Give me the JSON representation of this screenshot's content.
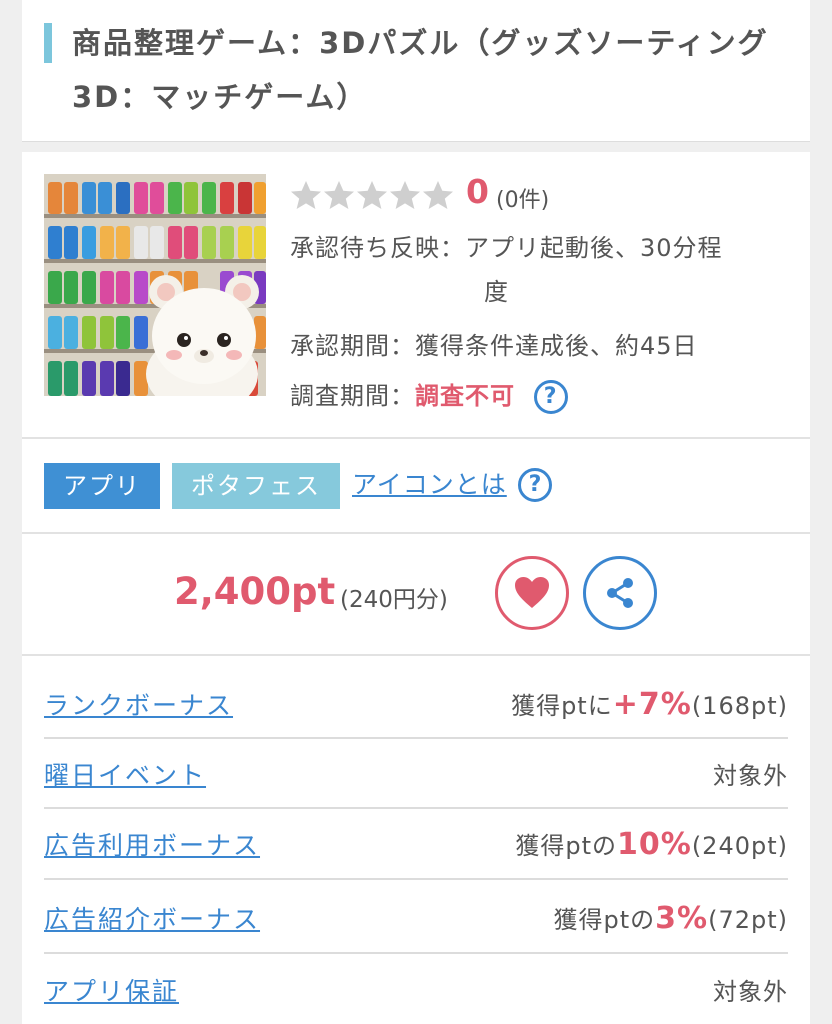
{
  "title": "商品整理ゲーム：3Dパズル（グッズソーティング3D：マッチゲーム）",
  "rating": {
    "value": "0",
    "count": "(0件)",
    "stars_filled": 0,
    "stars_total": 5
  },
  "info": {
    "approval_reflect_label": "承認待ち反映：",
    "approval_reflect_value": "アプリ起動後、30分程",
    "approval_reflect_value2": "度",
    "approval_period_label": "承認期間：",
    "approval_period_value": "獲得条件達成後、約45日",
    "investigation_label": "調査期間：",
    "investigation_value": "調査不可"
  },
  "tags": {
    "app": "アプリ",
    "fes": "ポタフェス",
    "icon_link": "アイコンとは"
  },
  "points": {
    "value": "2,400pt",
    "yen": "(240円分)"
  },
  "bonuses": [
    {
      "label": "ランクボーナス",
      "prefix": "獲得ptに",
      "highlight": "+7%",
      "suffix": "(168pt)"
    },
    {
      "label": "曜日イベント",
      "prefix": "対象外",
      "highlight": "",
      "suffix": ""
    },
    {
      "label": "広告利用ボーナス",
      "prefix": "獲得ptの",
      "highlight": "10%",
      "suffix": "(240pt)"
    },
    {
      "label": "広告紹介ボーナス",
      "prefix": "獲得ptの",
      "highlight": "3%",
      "suffix": "(72pt)"
    },
    {
      "label": "アプリ保証",
      "prefix": "対象外",
      "highlight": "",
      "suffix": ""
    }
  ],
  "colors": {
    "accent_red": "#e05a6e",
    "accent_blue": "#3a86d0",
    "title_bar": "#7cc6dc",
    "tag_app": "#3f90d4",
    "tag_fes": "#86c9dc"
  }
}
